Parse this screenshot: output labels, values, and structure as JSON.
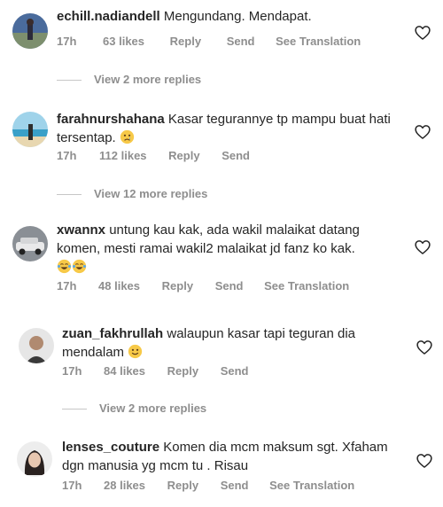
{
  "comments": [
    {
      "username": "echill.nadiandell",
      "text": "Mengundang. Mendapat.",
      "time": "17h",
      "likes": "63 likes",
      "reply": "Reply",
      "send": "Send",
      "translate": "See Translation",
      "replies_label": "View 2 more replies"
    },
    {
      "username": "farahnurshahana",
      "text": "Kasar tegurannye tp mampu buat hati tersentap.",
      "time": "17h",
      "likes": "112 likes",
      "reply": "Reply",
      "send": "Send",
      "replies_label": "View 12 more replies"
    },
    {
      "username": "xwannx",
      "text": "untung kau kak, ada wakil malaikat datang komen, mesti ramai wakil2 malaikat jd fanz ko kak.",
      "time": "17h",
      "likes": "48 likes",
      "reply": "Reply",
      "send": "Send",
      "translate": "See Translation"
    },
    {
      "username": "zuan_fakhrullah",
      "text": "walaupun kasar tapi teguran dia mendalam",
      "time": "17h",
      "likes": "84 likes",
      "reply": "Reply",
      "send": "Send",
      "replies_label": "View 2 more replies"
    },
    {
      "username": "lenses_couture",
      "text": "Komen dia mcm maksum sgt. Xfaham dgn manusia yg mcm tu . Risau",
      "time": "17h",
      "likes": "28 likes",
      "reply": "Reply",
      "send": "Send",
      "translate": "See Translation"
    }
  ],
  "icons": {
    "heart": "heart-outline-icon",
    "sad_emoji": "sad-face-emoji",
    "laugh_emoji": "tears-of-joy-emoji",
    "smile_emoji": "slight-smile-emoji"
  },
  "colors": {
    "text": "#262626",
    "secondary": "#8e8e8e",
    "divider": "#c7c7c7",
    "emoji": "#f7c948"
  }
}
